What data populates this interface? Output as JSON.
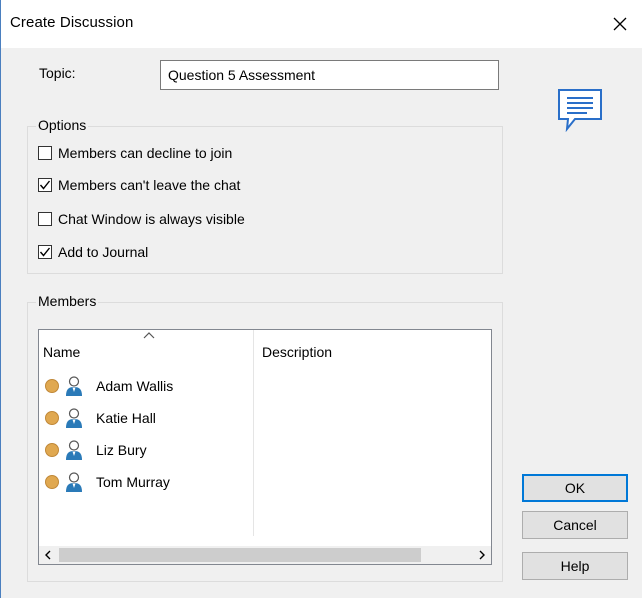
{
  "window": {
    "title": "Create Discussion"
  },
  "topic": {
    "label": "Topic:",
    "value": "Question 5 Assessment"
  },
  "options": {
    "legend": "Options",
    "items": [
      {
        "label": "Members can decline to join",
        "checked": false
      },
      {
        "label": "Members can't leave the chat",
        "checked": true
      },
      {
        "label": "Chat Window is always visible",
        "checked": false
      },
      {
        "label": "Add to Journal",
        "checked": true
      }
    ]
  },
  "members": {
    "legend": "Members",
    "columns": {
      "name": "Name",
      "description": "Description"
    },
    "rows": [
      {
        "name": "Adam Wallis",
        "status_color": "#e0a850",
        "icon": "user-icon"
      },
      {
        "name": "Katie Hall",
        "status_color": "#e0a850",
        "icon": "user-icon"
      },
      {
        "name": "Liz Bury",
        "status_color": "#e0a850",
        "icon": "user-icon"
      },
      {
        "name": "Tom Murray",
        "status_color": "#e0a850",
        "icon": "user-icon"
      }
    ]
  },
  "buttons": {
    "ok": "OK",
    "cancel": "Cancel",
    "help": "Help"
  },
  "colors": {
    "accent": "#0078d7",
    "status_away": "#e0a850",
    "chat_icon": "#2a6fc9"
  }
}
